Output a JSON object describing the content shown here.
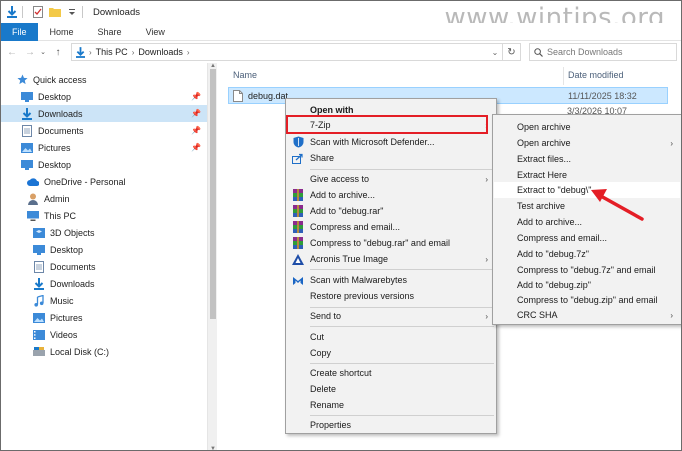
{
  "window": {
    "title": "Downloads"
  },
  "watermark": "www.wintips.org",
  "ribbon": {
    "tabs": [
      "File",
      "Home",
      "Share",
      "View"
    ]
  },
  "address": {
    "crumbs": [
      "This PC",
      "Downloads"
    ]
  },
  "search": {
    "placeholder": "Search Downloads"
  },
  "nav": {
    "items": [
      {
        "label": "Quick access",
        "icon": "star-icon"
      },
      {
        "label": "Desktop",
        "icon": "desktop-folder-icon",
        "pinned": true
      },
      {
        "label": "Downloads",
        "icon": "download-arrow-icon",
        "pinned": true,
        "selected": true
      },
      {
        "label": "Documents",
        "icon": "documents-icon",
        "pinned": true
      },
      {
        "label": "Pictures",
        "icon": "pictures-icon",
        "pinned": true
      },
      {
        "label": "Desktop",
        "icon": "desktop-folder-icon"
      },
      {
        "label": "OneDrive - Personal",
        "icon": "cloud-icon"
      },
      {
        "label": "Admin",
        "icon": "user-icon"
      },
      {
        "label": "This PC",
        "icon": "computer-icon"
      },
      {
        "label": "3D Objects",
        "icon": "3d-objects-icon"
      },
      {
        "label": "Desktop",
        "icon": "desktop-folder-icon"
      },
      {
        "label": "Documents",
        "icon": "documents-icon"
      },
      {
        "label": "Downloads",
        "icon": "download-arrow-icon"
      },
      {
        "label": "Music",
        "icon": "music-icon"
      },
      {
        "label": "Pictures",
        "icon": "pictures-icon"
      },
      {
        "label": "Videos",
        "icon": "videos-icon"
      },
      {
        "label": "Local Disk (C:)",
        "icon": "disk-icon"
      }
    ]
  },
  "content": {
    "columns": [
      "Name",
      "Date modified"
    ],
    "files": [
      {
        "name": "debug.dat",
        "date": "11/11/2025 18:32"
      }
    ],
    "partial_date": "3/3/2026 10:07"
  },
  "context_menu": {
    "items": [
      {
        "label": "Open with",
        "bold": true
      },
      {
        "label": "7-Zip",
        "submenu": true,
        "highlighted": true
      },
      {
        "label": "Scan with Microsoft Defender...",
        "icon": "defender-icon"
      },
      {
        "label": "Share",
        "icon": "share-icon"
      },
      {
        "label": "Give access to",
        "submenu": true
      },
      {
        "label": "Add to archive...",
        "icon": "winrar-icon"
      },
      {
        "label": "Add to \"debug.rar\"",
        "icon": "winrar-icon"
      },
      {
        "label": "Compress and email...",
        "icon": "winrar-icon"
      },
      {
        "label": "Compress to \"debug.rar\" and email",
        "icon": "winrar-icon"
      },
      {
        "label": "Acronis True Image",
        "icon": "acronis-icon",
        "submenu": true
      },
      {
        "label": "Scan with Malwarebytes",
        "icon": "malwarebytes-icon"
      },
      {
        "label": "Restore previous versions"
      },
      {
        "label": "Send to",
        "submenu": true
      },
      {
        "label": "Cut"
      },
      {
        "label": "Copy"
      },
      {
        "label": "Create shortcut"
      },
      {
        "label": "Delete"
      },
      {
        "label": "Rename"
      },
      {
        "label": "Properties"
      }
    ]
  },
  "zip_menu": {
    "items": [
      "Open archive",
      "Open archive",
      "Extract files...",
      "Extract Here",
      "Extract to \"debug\\\"",
      "Test archive",
      "Add to archive...",
      "Compress and email...",
      "Add to \"debug.7z\"",
      "Compress to \"debug.7z\" and email",
      "Add to \"debug.zip\"",
      "Compress to \"debug.zip\" and email",
      "CRC SHA"
    ],
    "open_archive_arrow": "›",
    "highlighted_index": 4
  },
  "colors": {
    "accent": "#1979ca",
    "selection": "#cce4f7",
    "annotation": "#e41e26"
  }
}
